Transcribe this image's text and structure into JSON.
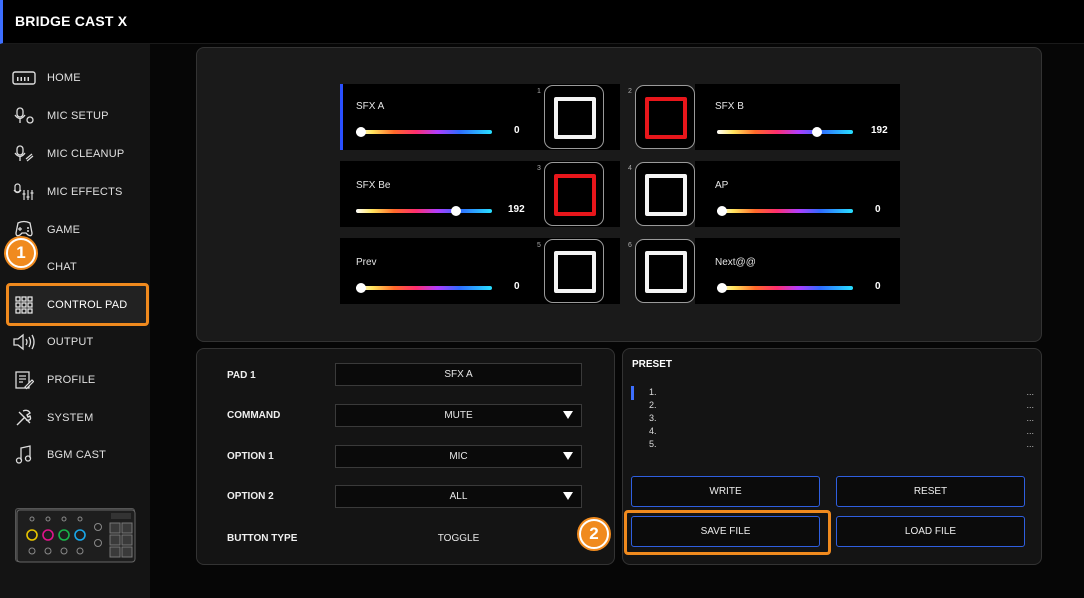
{
  "app": {
    "title": "BRIDGE CAST X",
    "accent": "#3d6fff",
    "callout_color": "#f08a1e"
  },
  "sidebar": {
    "items": [
      {
        "label": "HOME",
        "icon": "home-icon"
      },
      {
        "label": "MIC SETUP",
        "icon": "mic-setup-icon"
      },
      {
        "label": "MIC CLEANUP",
        "icon": "mic-cleanup-icon"
      },
      {
        "label": "MIC EFFECTS",
        "icon": "mic-effects-icon"
      },
      {
        "label": "GAME",
        "icon": "gamepad-icon"
      },
      {
        "label": "CHAT",
        "icon": "chat-icon"
      },
      {
        "label": "CONTROL PAD",
        "icon": "grid-icon",
        "active": true
      },
      {
        "label": "OUTPUT",
        "icon": "speaker-icon"
      },
      {
        "label": "PROFILE",
        "icon": "profile-icon"
      },
      {
        "label": "SYSTEM",
        "icon": "wrench-icon"
      },
      {
        "label": "BGM CAST",
        "icon": "music-note-icon"
      }
    ]
  },
  "callouts": {
    "one": "1",
    "two": "2"
  },
  "pads": [
    {
      "num": "1",
      "name": "SFX A",
      "value": "0",
      "level": 0,
      "color": "white"
    },
    {
      "num": "2",
      "name": "SFX B",
      "value": "192",
      "level": 0.75,
      "color": "red"
    },
    {
      "num": "3",
      "name": "SFX Be",
      "value": "192",
      "level": 0.75,
      "color": "red"
    },
    {
      "num": "4",
      "name": "AP",
      "value": "0",
      "level": 0,
      "color": "white"
    },
    {
      "num": "5",
      "name": "Prev",
      "value": "0",
      "level": 0,
      "color": "white"
    },
    {
      "num": "6",
      "name": "Next@@",
      "value": "0",
      "level": 0,
      "color": "white"
    }
  ],
  "settings": {
    "pad_label": "PAD 1",
    "pad_name": "SFX A",
    "command_label": "COMMAND",
    "command_value": "MUTE",
    "option1_label": "OPTION 1",
    "option1_value": "MIC",
    "option2_label": "OPTION 2",
    "option2_value": "ALL",
    "button_type_label": "BUTTON TYPE",
    "button_type_value": "TOGGLE"
  },
  "preset": {
    "title": "PRESET",
    "items": [
      {
        "num": "1.",
        "dots": "..."
      },
      {
        "num": "2.",
        "dots": "..."
      },
      {
        "num": "3.",
        "dots": "..."
      },
      {
        "num": "4.",
        "dots": "..."
      },
      {
        "num": "5.",
        "dots": "..."
      }
    ],
    "write": "WRITE",
    "reset": "RESET",
    "save_file": "SAVE FILE",
    "load_file": "LOAD FILE"
  }
}
